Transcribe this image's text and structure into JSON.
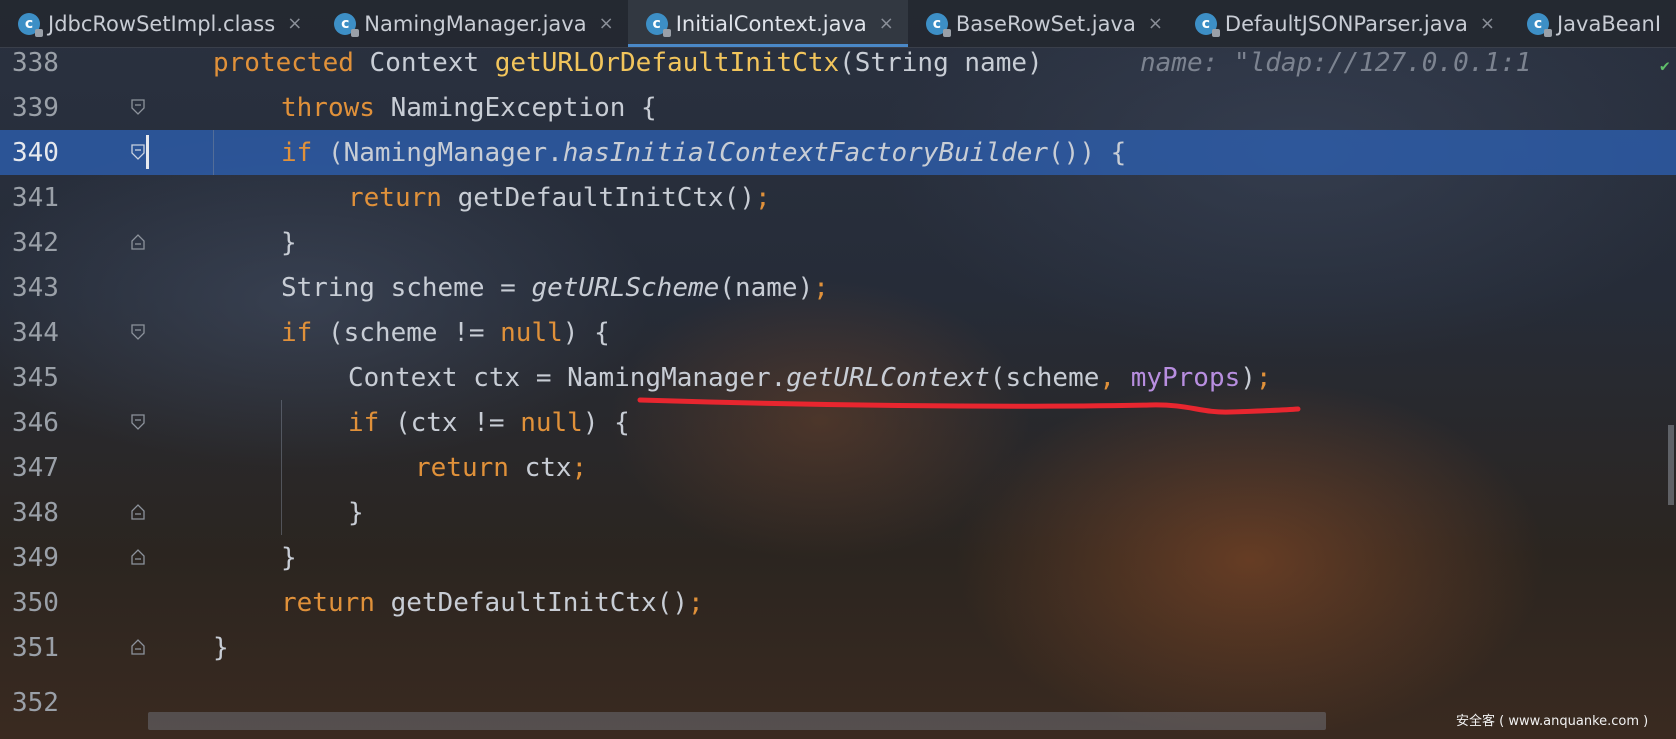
{
  "tabs": [
    {
      "label": "JdbcRowSetImpl.class",
      "icon": "class-icon",
      "locked": true
    },
    {
      "label": "NamingManager.java",
      "icon": "class-icon",
      "locked": true
    },
    {
      "label": "InitialContext.java",
      "icon": "class-icon",
      "locked": true,
      "active": true
    },
    {
      "label": "BaseRowSet.java",
      "icon": "class-icon",
      "locked": true
    },
    {
      "label": "DefaultJSONParser.java",
      "icon": "class-icon",
      "locked": true
    },
    {
      "label": "JavaBeanI",
      "icon": "class-icon",
      "locked": true
    }
  ],
  "close_glyph": "×",
  "tab_icon_letter": "c",
  "current_line": "340",
  "lines": [
    {
      "num": "338"
    },
    {
      "num": "339"
    },
    {
      "num": "340"
    },
    {
      "num": "341"
    },
    {
      "num": "342"
    },
    {
      "num": "343"
    },
    {
      "num": "344"
    },
    {
      "num": "345"
    },
    {
      "num": "346"
    },
    {
      "num": "347"
    },
    {
      "num": "348"
    },
    {
      "num": "349"
    },
    {
      "num": "350"
    },
    {
      "num": "351"
    },
    {
      "num": "352"
    }
  ],
  "code": {
    "l338": {
      "kw": "protected",
      "type": " Context ",
      "fn": "getURLOrDefaultInitCtx",
      "rest": "(String name)",
      "hint": "name: \"ldap://127.0.0.1:1"
    },
    "l339": {
      "kw": "throws",
      "rest": " NamingException {"
    },
    "l340": {
      "kw": "if",
      "a": " (NamingManager.",
      "it": "hasInitialContextFactoryBuilder",
      "b": "()) {"
    },
    "l341": {
      "kw": "return",
      "rest": " getDefaultInitCtx()",
      "semi": ";"
    },
    "l342": {
      "rest": "}"
    },
    "l343": {
      "a": "String scheme = ",
      "it": "getURLScheme",
      "b": "(name)",
      "semi": ";"
    },
    "l344": {
      "kw": "if",
      "a": " (scheme != ",
      "kw2": "null",
      "b": ") {"
    },
    "l345": {
      "a": "Context ctx = NamingManager.",
      "it": "getURLContext",
      "b": "(scheme",
      "comma": ", ",
      "field": "myProps",
      "c": ")",
      "semi": ";"
    },
    "l346": {
      "kw": "if",
      "a": " (ctx != ",
      "kw2": "null",
      "b": ") {"
    },
    "l347": {
      "kw": "return",
      "rest": " ctx",
      "semi": ";"
    },
    "l348": {
      "rest": "}"
    },
    "l349": {
      "rest": "}"
    },
    "l350": {
      "kw": "return",
      "rest": " getDefaultInitCtx()",
      "semi": ";"
    },
    "l351": {
      "rest": "}"
    }
  },
  "annotation_color": "#e8262f",
  "watermark": "安全客 ( www.anquanke.com )"
}
